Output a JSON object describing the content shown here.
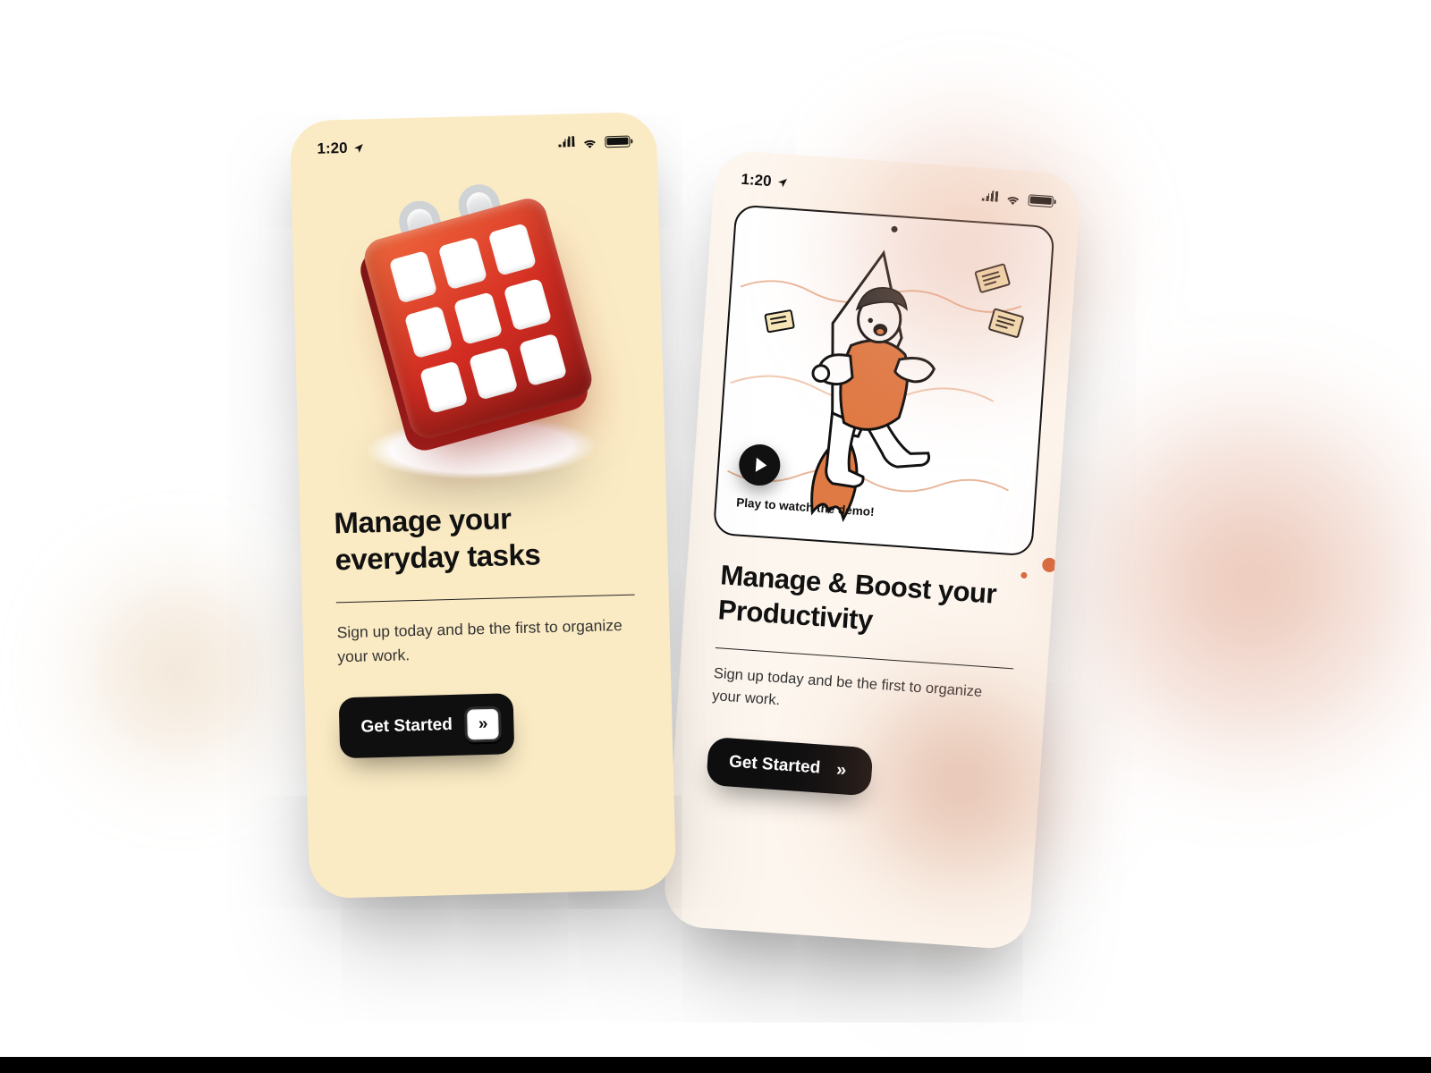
{
  "status": {
    "time": "1:20"
  },
  "screen1": {
    "title": "Manage your everyday tasks",
    "subtitle": "Sign up today and be the first to organize your work.",
    "cta": "Get Started",
    "cta_arrow": "»"
  },
  "screen2": {
    "title": "Manage & Boost your Productivity",
    "subtitle": "Sign up today and be the first to organize your work.",
    "demo_label": "Play to watch the demo!",
    "cta": "Get Started",
    "cta_arrow": "»"
  }
}
